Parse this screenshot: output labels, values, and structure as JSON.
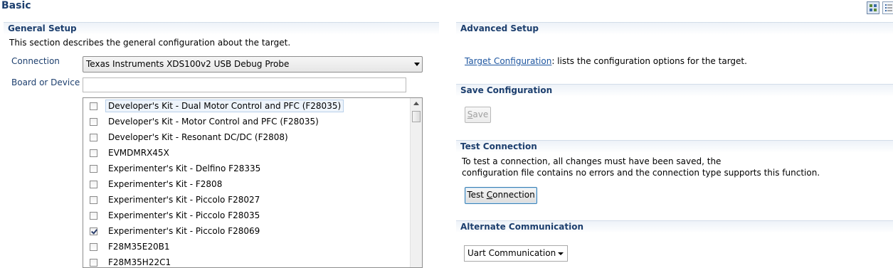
{
  "page": {
    "title": "Basic",
    "view_toggles": [
      {
        "icon": "grid-view-icon",
        "active": true
      },
      {
        "icon": "list-view-icon",
        "active": false
      }
    ]
  },
  "general_setup": {
    "header": "General Setup",
    "description": "This section describes the general configuration about the target.",
    "connection_label": "Connection",
    "connection_value": "Texas Instruments XDS100v2 USB Debug Probe",
    "board_label": "Board or Device",
    "board_filter_value": "",
    "devices": [
      {
        "label": "Developer's Kit - Dual Motor Control and PFC (F28035)",
        "checked": false,
        "selected": true
      },
      {
        "label": "Developer's Kit - Motor Control and PFC (F28035)",
        "checked": false
      },
      {
        "label": "Developer's Kit - Resonant DC/DC (F2808)",
        "checked": false
      },
      {
        "label": "EVMDMRX45X",
        "checked": false
      },
      {
        "label": "Experimenter's Kit - Delfino F28335",
        "checked": false
      },
      {
        "label": "Experimenter's Kit - F2808",
        "checked": false
      },
      {
        "label": "Experimenter's Kit - Piccolo F28027",
        "checked": false
      },
      {
        "label": "Experimenter's Kit - Piccolo F28035",
        "checked": false
      },
      {
        "label": "Experimenter's Kit - Piccolo F28069",
        "checked": true
      },
      {
        "label": "F28M35E20B1",
        "checked": false
      },
      {
        "label": "F28M35H22C1",
        "checked": false
      }
    ]
  },
  "advanced_setup": {
    "header": "Advanced Setup",
    "link_text": "Target Configuration",
    "link_suffix": ": lists the configuration options for the target."
  },
  "save_configuration": {
    "header": "Save Configuration",
    "button_mnemonic": "S",
    "button_rest": "ave"
  },
  "test_connection": {
    "header": "Test Connection",
    "line1": "To test a connection, all changes must have been saved, the",
    "line2": "configuration file contains no errors and the connection type supports this function.",
    "button_pre": "Test ",
    "button_mnemonic": "C",
    "button_rest": "onnection"
  },
  "alternate_communication": {
    "header": "Alternate Communication",
    "selected": "Uart Communication"
  }
}
